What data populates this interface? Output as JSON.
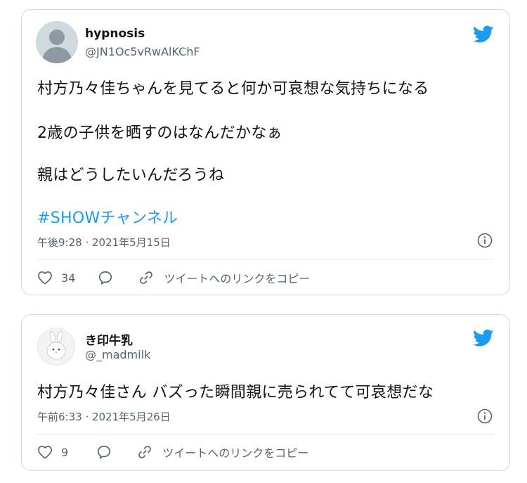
{
  "tweets": [
    {
      "display_name": "hypnosis",
      "handle": "@JN1Oc5vRwAlKChF",
      "lines": [
        "村方乃々佳ちゃんを見てると何か可哀想な気持ちになる",
        "2歳の子供を晒すのはなんだかなぁ",
        "親はどうしたいんだろうね"
      ],
      "hashtag": "#SHOWチャンネル",
      "timestamp": "午後9:28 · 2021年5月15日",
      "likes": "34",
      "copy_link_label": "ツイートへのリンクをコピー",
      "icons": [
        "twitter-bird-icon",
        "info-icon",
        "heart-icon",
        "reply-icon",
        "link-icon"
      ]
    },
    {
      "display_name": "き印牛乳",
      "handle": "@_madmilk",
      "lines": [
        "村方乃々佳さん バズった瞬間親に売られてて可哀想だな"
      ],
      "timestamp": "午前6:33 · 2021年5月26日",
      "likes": "9",
      "copy_link_label": "ツイートへのリンクをコピー",
      "icons": [
        "twitter-bird-icon",
        "info-icon",
        "heart-icon",
        "reply-icon",
        "link-icon"
      ]
    }
  ],
  "colors": {
    "accent": "#1d9bf0",
    "text": "#0f1419",
    "secondary": "#536471",
    "border": "#cfd9de"
  }
}
